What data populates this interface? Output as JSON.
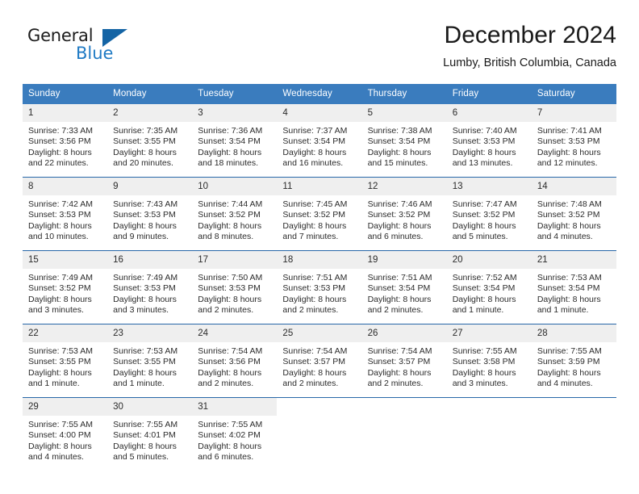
{
  "brand": {
    "name_part1": "General",
    "name_part2": "Blue",
    "logo_icon": "triangle-logo-icon",
    "accent_color": "#1464a5",
    "text_blue": "#1f7ac4"
  },
  "header": {
    "title": "December 2024",
    "subtitle": "Lumby, British Columbia, Canada"
  },
  "calendar": {
    "header_bg": "#3a7cbe",
    "daynum_bg": "#efefef",
    "row_divider": "#2767a8",
    "weekday_names": [
      "Sunday",
      "Monday",
      "Tuesday",
      "Wednesday",
      "Thursday",
      "Friday",
      "Saturday"
    ],
    "weeks": [
      [
        {
          "day": "1",
          "sunrise": "Sunrise: 7:33 AM",
          "sunset": "Sunset: 3:56 PM",
          "daylight_line1": "Daylight: 8 hours",
          "daylight_line2": "and 22 minutes."
        },
        {
          "day": "2",
          "sunrise": "Sunrise: 7:35 AM",
          "sunset": "Sunset: 3:55 PM",
          "daylight_line1": "Daylight: 8 hours",
          "daylight_line2": "and 20 minutes."
        },
        {
          "day": "3",
          "sunrise": "Sunrise: 7:36 AM",
          "sunset": "Sunset: 3:54 PM",
          "daylight_line1": "Daylight: 8 hours",
          "daylight_line2": "and 18 minutes."
        },
        {
          "day": "4",
          "sunrise": "Sunrise: 7:37 AM",
          "sunset": "Sunset: 3:54 PM",
          "daylight_line1": "Daylight: 8 hours",
          "daylight_line2": "and 16 minutes."
        },
        {
          "day": "5",
          "sunrise": "Sunrise: 7:38 AM",
          "sunset": "Sunset: 3:54 PM",
          "daylight_line1": "Daylight: 8 hours",
          "daylight_line2": "and 15 minutes."
        },
        {
          "day": "6",
          "sunrise": "Sunrise: 7:40 AM",
          "sunset": "Sunset: 3:53 PM",
          "daylight_line1": "Daylight: 8 hours",
          "daylight_line2": "and 13 minutes."
        },
        {
          "day": "7",
          "sunrise": "Sunrise: 7:41 AM",
          "sunset": "Sunset: 3:53 PM",
          "daylight_line1": "Daylight: 8 hours",
          "daylight_line2": "and 12 minutes."
        }
      ],
      [
        {
          "day": "8",
          "sunrise": "Sunrise: 7:42 AM",
          "sunset": "Sunset: 3:53 PM",
          "daylight_line1": "Daylight: 8 hours",
          "daylight_line2": "and 10 minutes."
        },
        {
          "day": "9",
          "sunrise": "Sunrise: 7:43 AM",
          "sunset": "Sunset: 3:53 PM",
          "daylight_line1": "Daylight: 8 hours",
          "daylight_line2": "and 9 minutes."
        },
        {
          "day": "10",
          "sunrise": "Sunrise: 7:44 AM",
          "sunset": "Sunset: 3:52 PM",
          "daylight_line1": "Daylight: 8 hours",
          "daylight_line2": "and 8 minutes."
        },
        {
          "day": "11",
          "sunrise": "Sunrise: 7:45 AM",
          "sunset": "Sunset: 3:52 PM",
          "daylight_line1": "Daylight: 8 hours",
          "daylight_line2": "and 7 minutes."
        },
        {
          "day": "12",
          "sunrise": "Sunrise: 7:46 AM",
          "sunset": "Sunset: 3:52 PM",
          "daylight_line1": "Daylight: 8 hours",
          "daylight_line2": "and 6 minutes."
        },
        {
          "day": "13",
          "sunrise": "Sunrise: 7:47 AM",
          "sunset": "Sunset: 3:52 PM",
          "daylight_line1": "Daylight: 8 hours",
          "daylight_line2": "and 5 minutes."
        },
        {
          "day": "14",
          "sunrise": "Sunrise: 7:48 AM",
          "sunset": "Sunset: 3:52 PM",
          "daylight_line1": "Daylight: 8 hours",
          "daylight_line2": "and 4 minutes."
        }
      ],
      [
        {
          "day": "15",
          "sunrise": "Sunrise: 7:49 AM",
          "sunset": "Sunset: 3:52 PM",
          "daylight_line1": "Daylight: 8 hours",
          "daylight_line2": "and 3 minutes."
        },
        {
          "day": "16",
          "sunrise": "Sunrise: 7:49 AM",
          "sunset": "Sunset: 3:53 PM",
          "daylight_line1": "Daylight: 8 hours",
          "daylight_line2": "and 3 minutes."
        },
        {
          "day": "17",
          "sunrise": "Sunrise: 7:50 AM",
          "sunset": "Sunset: 3:53 PM",
          "daylight_line1": "Daylight: 8 hours",
          "daylight_line2": "and 2 minutes."
        },
        {
          "day": "18",
          "sunrise": "Sunrise: 7:51 AM",
          "sunset": "Sunset: 3:53 PM",
          "daylight_line1": "Daylight: 8 hours",
          "daylight_line2": "and 2 minutes."
        },
        {
          "day": "19",
          "sunrise": "Sunrise: 7:51 AM",
          "sunset": "Sunset: 3:54 PM",
          "daylight_line1": "Daylight: 8 hours",
          "daylight_line2": "and 2 minutes."
        },
        {
          "day": "20",
          "sunrise": "Sunrise: 7:52 AM",
          "sunset": "Sunset: 3:54 PM",
          "daylight_line1": "Daylight: 8 hours",
          "daylight_line2": "and 1 minute."
        },
        {
          "day": "21",
          "sunrise": "Sunrise: 7:53 AM",
          "sunset": "Sunset: 3:54 PM",
          "daylight_line1": "Daylight: 8 hours",
          "daylight_line2": "and 1 minute."
        }
      ],
      [
        {
          "day": "22",
          "sunrise": "Sunrise: 7:53 AM",
          "sunset": "Sunset: 3:55 PM",
          "daylight_line1": "Daylight: 8 hours",
          "daylight_line2": "and 1 minute."
        },
        {
          "day": "23",
          "sunrise": "Sunrise: 7:53 AM",
          "sunset": "Sunset: 3:55 PM",
          "daylight_line1": "Daylight: 8 hours",
          "daylight_line2": "and 1 minute."
        },
        {
          "day": "24",
          "sunrise": "Sunrise: 7:54 AM",
          "sunset": "Sunset: 3:56 PM",
          "daylight_line1": "Daylight: 8 hours",
          "daylight_line2": "and 2 minutes."
        },
        {
          "day": "25",
          "sunrise": "Sunrise: 7:54 AM",
          "sunset": "Sunset: 3:57 PM",
          "daylight_line1": "Daylight: 8 hours",
          "daylight_line2": "and 2 minutes."
        },
        {
          "day": "26",
          "sunrise": "Sunrise: 7:54 AM",
          "sunset": "Sunset: 3:57 PM",
          "daylight_line1": "Daylight: 8 hours",
          "daylight_line2": "and 2 minutes."
        },
        {
          "day": "27",
          "sunrise": "Sunrise: 7:55 AM",
          "sunset": "Sunset: 3:58 PM",
          "daylight_line1": "Daylight: 8 hours",
          "daylight_line2": "and 3 minutes."
        },
        {
          "day": "28",
          "sunrise": "Sunrise: 7:55 AM",
          "sunset": "Sunset: 3:59 PM",
          "daylight_line1": "Daylight: 8 hours",
          "daylight_line2": "and 4 minutes."
        }
      ],
      [
        {
          "day": "29",
          "sunrise": "Sunrise: 7:55 AM",
          "sunset": "Sunset: 4:00 PM",
          "daylight_line1": "Daylight: 8 hours",
          "daylight_line2": "and 4 minutes."
        },
        {
          "day": "30",
          "sunrise": "Sunrise: 7:55 AM",
          "sunset": "Sunset: 4:01 PM",
          "daylight_line1": "Daylight: 8 hours",
          "daylight_line2": "and 5 minutes."
        },
        {
          "day": "31",
          "sunrise": "Sunrise: 7:55 AM",
          "sunset": "Sunset: 4:02 PM",
          "daylight_line1": "Daylight: 8 hours",
          "daylight_line2": "and 6 minutes."
        },
        {
          "day": "",
          "sunrise": "",
          "sunset": "",
          "daylight_line1": "",
          "daylight_line2": ""
        },
        {
          "day": "",
          "sunrise": "",
          "sunset": "",
          "daylight_line1": "",
          "daylight_line2": ""
        },
        {
          "day": "",
          "sunrise": "",
          "sunset": "",
          "daylight_line1": "",
          "daylight_line2": ""
        },
        {
          "day": "",
          "sunrise": "",
          "sunset": "",
          "daylight_line1": "",
          "daylight_line2": ""
        }
      ]
    ]
  }
}
